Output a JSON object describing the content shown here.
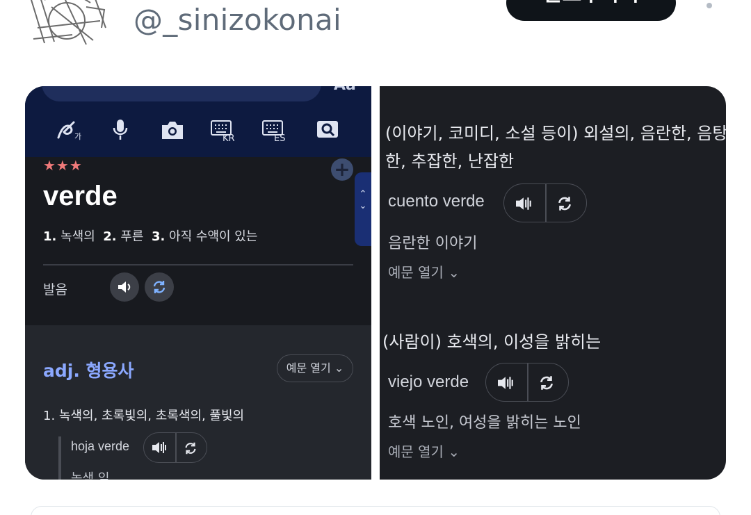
{
  "header": {
    "handle": "@_sinizokonai",
    "follow_label": "팔로우하기"
  },
  "left_card": {
    "search_value": "verde",
    "search_right": "Aa",
    "toolbar_icons": [
      "handwriting-icon",
      "microphone-icon",
      "camera-icon",
      "keyboard-kr-icon",
      "keyboard-es-icon",
      "scan-icon"
    ],
    "toolbar_kr": "KR",
    "toolbar_es": "ES",
    "stars": "★★★",
    "word": "verde",
    "meanings": [
      {
        "num": "1.",
        "text": "녹색의"
      },
      {
        "num": "2.",
        "text": "푸른"
      },
      {
        "num": "3.",
        "text": "아직 수액이 있는"
      }
    ],
    "pronunciation_label": "발음",
    "pos": "adj. 형용사",
    "example_open_pill": "예문 열기 ⌄",
    "sense_1": "1.  녹색의, 초록빛의, 초록색의, 풀빛의",
    "example_phrase": "hoja verde",
    "example_translation": "녹색 잎"
  },
  "right_card": {
    "sense_a_line1": "(이야기, 코미디, 소설 등이) 외설의, 음란한, 음탕",
    "sense_a_line2": "한, 추잡한, 난잡한",
    "example_a": "cuento verde",
    "example_a_translation": "음란한 이야기",
    "example_a_open": "예문 열기 ⌄",
    "sense_b": "(사람이) 호색의, 이성을 밝히는",
    "example_b": "viejo verde",
    "example_b_translation": "호색 노인, 여성을 밝히는 노인",
    "example_b_open": "예문 열기 ⌄"
  },
  "colors": {
    "accent_blue": "#8ba8ff",
    "star_red": "#f07a7a",
    "card_dark": "#1c1e23",
    "toolbar_navy": "#0d1a40"
  }
}
